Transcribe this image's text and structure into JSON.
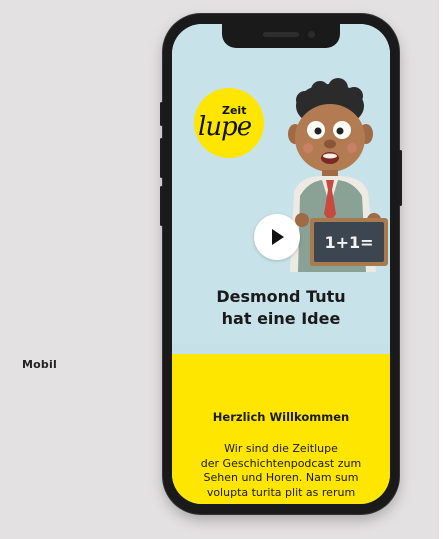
{
  "page": {
    "label": "Mobil"
  },
  "logo": {
    "top_word": "Zeit",
    "script_word": "lupe"
  },
  "hero": {
    "title_line1": "Desmond Tutu",
    "title_line2": "hat eine Idee",
    "chalkboard_text": "1+1=",
    "play_icon": "play-icon"
  },
  "welcome": {
    "heading": "Herzlich Willkommen",
    "line1": "Wir sind die Zeitlupe",
    "line2": "der Geschichtenpodcast zum",
    "line3": "Sehen und Horen. Nam sum",
    "line4": "volupta turita plit as rerum"
  },
  "colors": {
    "background": "#e4e1e2",
    "accent_yellow": "#ffe600",
    "hero_blue": "#c8e2ea",
    "phone_frame": "#1a1a1a"
  }
}
